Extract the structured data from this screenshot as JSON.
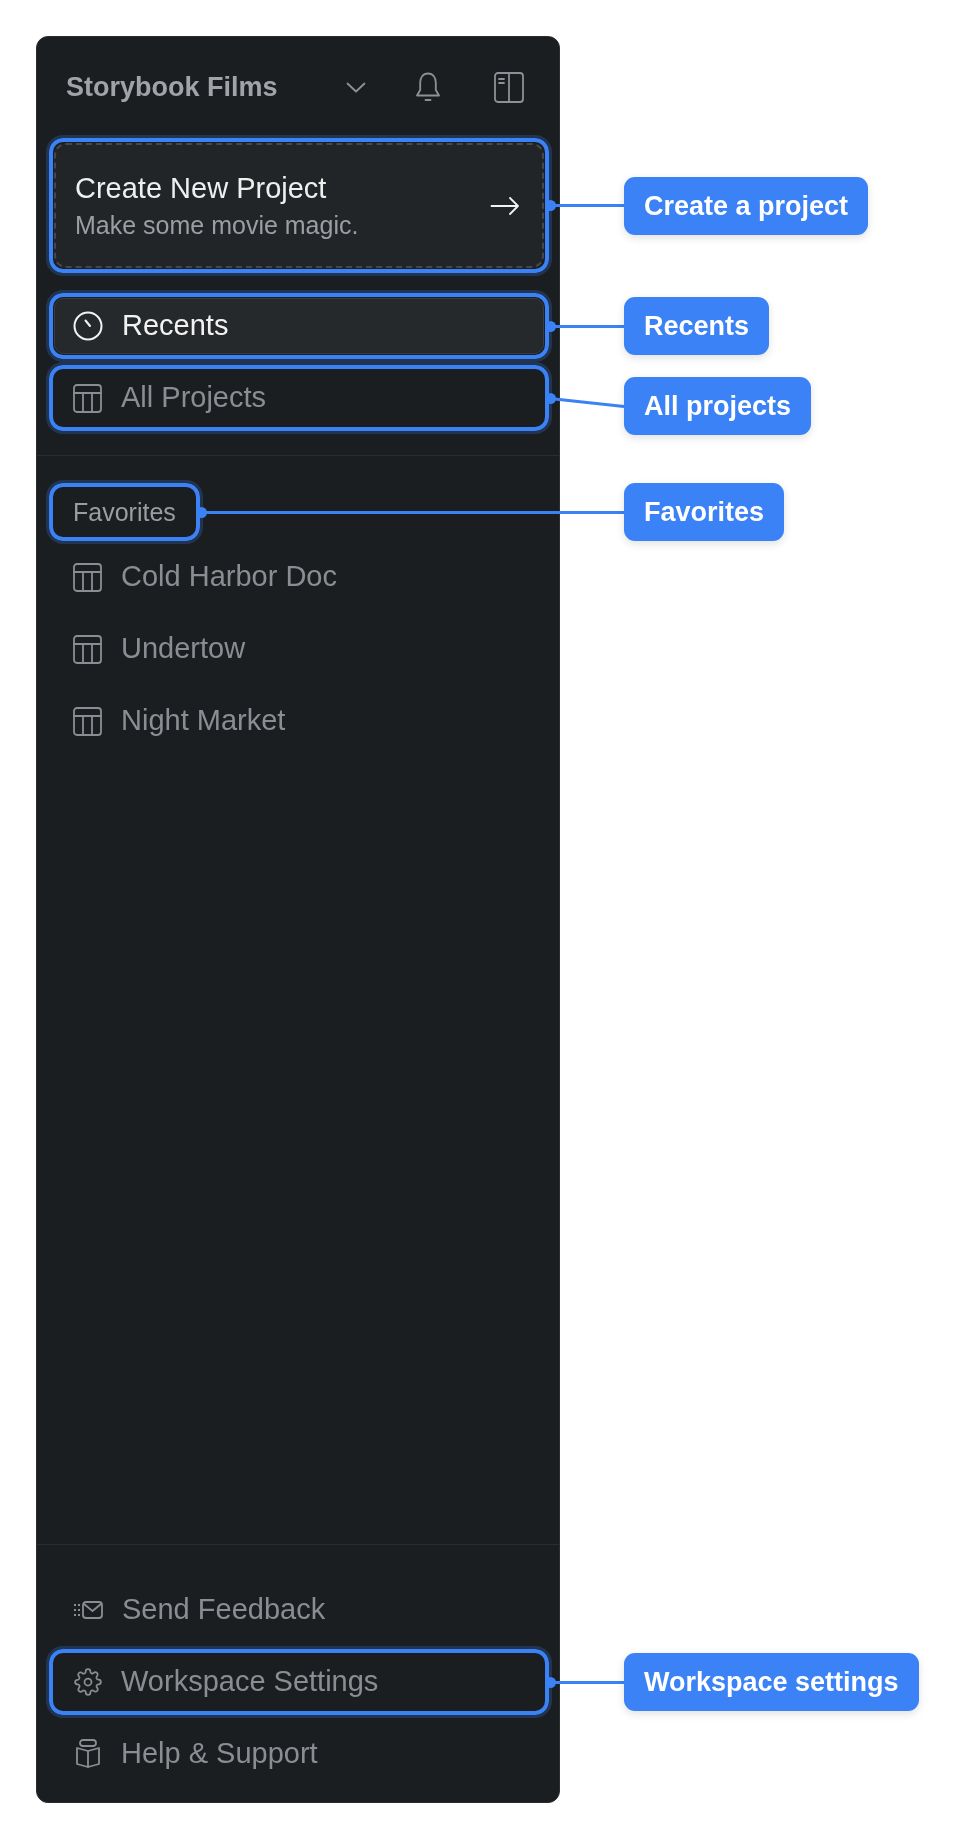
{
  "sidebar": {
    "workspace_name": "Storybook Films",
    "create_card": {
      "title": "Create New Project",
      "subtitle": "Make some movie magic.",
      "callout": "Create a project"
    },
    "nav_items": [
      {
        "label": "Recents",
        "selected": true,
        "callout": "Recents"
      },
      {
        "label": "All Projects",
        "selected": false,
        "callout": "All projects"
      }
    ],
    "favorites": {
      "heading": "Favorites",
      "callout": "Favorites",
      "items": [
        {
          "label": "Cold Harbor Doc",
          "selected": false
        },
        {
          "label": "Undertow",
          "selected": false
        },
        {
          "label": "Night Market",
          "selected": false
        }
      ]
    },
    "footer_items": [
      {
        "label": "Send Feedback"
      },
      {
        "label": "Workspace Settings",
        "callout": "Workspace settings"
      },
      {
        "label": "Help & Support"
      }
    ]
  }
}
